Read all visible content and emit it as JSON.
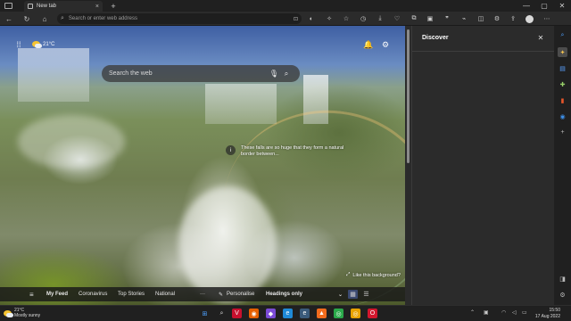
{
  "window": {
    "tab_title": "New tab",
    "new_tab_symbol": "+",
    "controls": [
      "—",
      "▢",
      "✕"
    ]
  },
  "toolbar": {
    "address_placeholder": "Search or enter web address",
    "icons": [
      "back-icon",
      "refresh-icon",
      "home-icon",
      "site-info-icon",
      "zoom-icon",
      "tracking-icon",
      "extension-icon",
      "favorites-icon",
      "collections-icon",
      "history-icon",
      "downloads-icon",
      "rewards-icon",
      "discover-icon",
      "screenshot-icon",
      "performance-icon",
      "split-icon",
      "settings-icon",
      "profile-icon",
      "more-icon"
    ]
  },
  "ntp": {
    "weather_temp": "21°C",
    "search_placeholder": "Search the web",
    "caption": "These falls are so huge that they form a natural border between...",
    "like_background": "Like this background?",
    "feed": {
      "items": [
        "My Feed",
        "Coronavirus",
        "Top Stories",
        "National"
      ],
      "more": "···",
      "personalise": "Personalise",
      "headings_only": "Headings only"
    }
  },
  "discover": {
    "title": "Discover"
  },
  "taskbar": {
    "weather_temp": "21°C",
    "weather_desc": "Mostly sunny",
    "time": "15:50",
    "date": "17 Aug 2022"
  },
  "colors": {
    "accent": "#0078d4",
    "sky": "#3e5fa3",
    "foliage": "#6f7d50"
  }
}
